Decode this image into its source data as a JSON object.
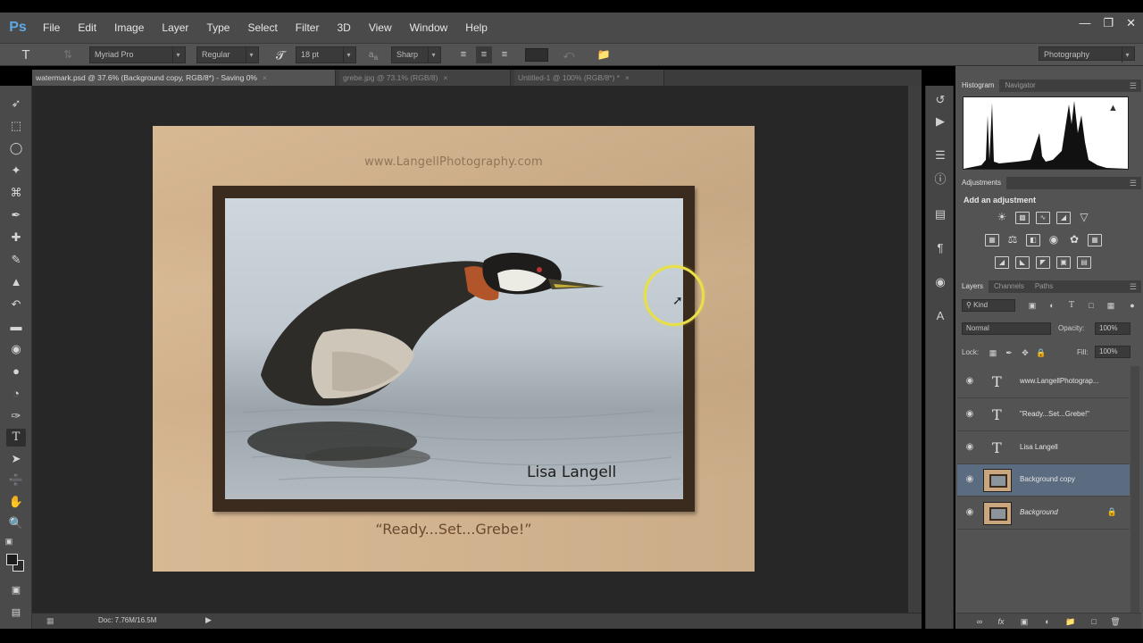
{
  "app": {
    "logo": "Ps",
    "menu": [
      "File",
      "Edit",
      "Image",
      "Layer",
      "Type",
      "Select",
      "Filter",
      "3D",
      "View",
      "Window",
      "Help"
    ],
    "window_controls": [
      "minimize-icon",
      "restore-icon",
      "close-icon"
    ]
  },
  "options_bar": {
    "font_family": "Myriad Pro",
    "font_style": "Regular",
    "font_size": "18 pt",
    "antialias": "Sharp",
    "workspace": "Photography"
  },
  "tabs": [
    {
      "label": "watermark.psd @ 37.6% (Background copy, RGB/8*) - Saving 0%",
      "active": true
    },
    {
      "label": "grebe.jpg @ 73.1% (RGB/8)",
      "active": false
    },
    {
      "label": "Untitled-1 @ 100% (RGB/8*) *",
      "active": false
    }
  ],
  "artwork": {
    "url_text": "www.LangellPhotography.com",
    "artist_text": "Lisa Langell",
    "caption_text": "“Ready...Set...Grebe!”"
  },
  "status": {
    "doc": "Doc: 7.76M/16.5M"
  },
  "panels": {
    "histogram_tabs": [
      "Histogram",
      "Navigator"
    ],
    "adjustments_tab": "Adjustments",
    "adjustments_title": "Add an adjustment",
    "layers_tabs": [
      "Layers",
      "Channels",
      "Paths"
    ],
    "kind_filter": "Kind",
    "blend_mode": "Normal",
    "opacity_label": "Opacity:",
    "opacity_value": "100%",
    "lock_label": "Lock:",
    "fill_label": "Fill:",
    "fill_value": "100%",
    "layers": [
      {
        "name": "www.LangellPhotograp...",
        "type": "text"
      },
      {
        "name": "\"Ready...Set...Grebe!\"",
        "type": "text"
      },
      {
        "name": "Lisa Langell",
        "type": "text"
      },
      {
        "name": "Background copy",
        "type": "image",
        "selected": true
      },
      {
        "name": "Background",
        "type": "image",
        "locked": true
      }
    ]
  },
  "colors": {
    "accent": "#5ea8e6",
    "mat": "#d6b690",
    "frame": "#3b2a1e",
    "selected_layer": "#5b6c80",
    "cursor_ring": "#e8e048"
  }
}
